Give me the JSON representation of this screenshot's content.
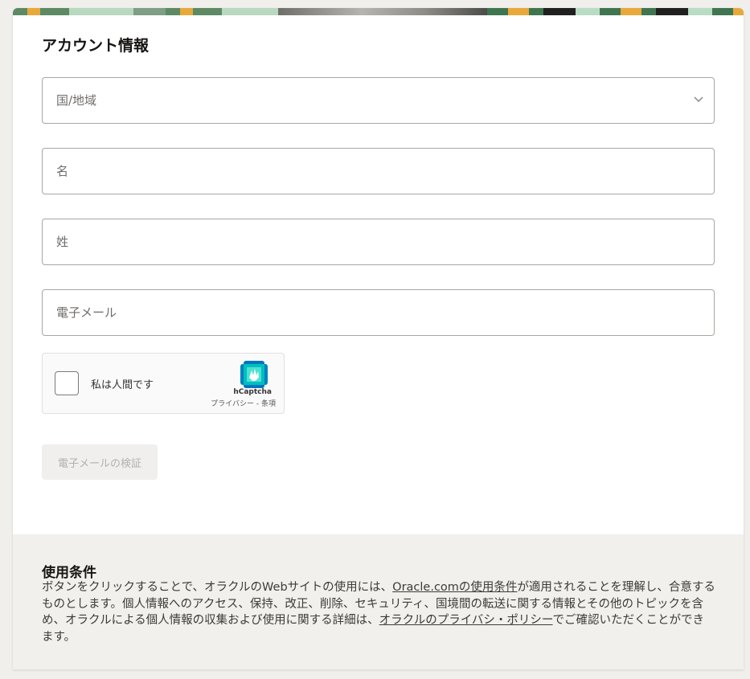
{
  "account_section": {
    "heading": "アカウント情報"
  },
  "form": {
    "country_placeholder": "国/地域",
    "first_name_placeholder": "名",
    "last_name_placeholder": "姓",
    "email_placeholder": "電子メール"
  },
  "captcha": {
    "label": "私は人間です",
    "brand": "hCaptcha",
    "privacy_link": "プライバシー",
    "separator": " - ",
    "terms_link": "条項"
  },
  "verify_button": {
    "label": "電子メールの検証"
  },
  "terms": {
    "title": "使用条件",
    "text_part1": "ボタンをクリックすることで、オラクルのWebサイトの使用には、",
    "link_terms": "Oracle.comの使用条件",
    "text_part2": "が適用されることを理解し、合意するものとします。個人情報へのアクセス、保持、改正、削除、セキュリティ、国境間の転送に関する情報とその他のトピックを含め、オラクルによる個人情報の収集および使用に関する詳細は、",
    "link_privacy": "オラクルのプライバシ・ポリシー",
    "text_part3": "でご確認いただくことができます。"
  },
  "colors": {
    "page_background": "#f1efec",
    "terms_background": "#f2f0ed",
    "field_border": "#a9a6a2",
    "disabled_button_bg": "#f1efed",
    "disabled_button_text": "#b3b0ad"
  },
  "icons": [
    "chevron-down-icon",
    "hcaptcha-logo-icon"
  ]
}
